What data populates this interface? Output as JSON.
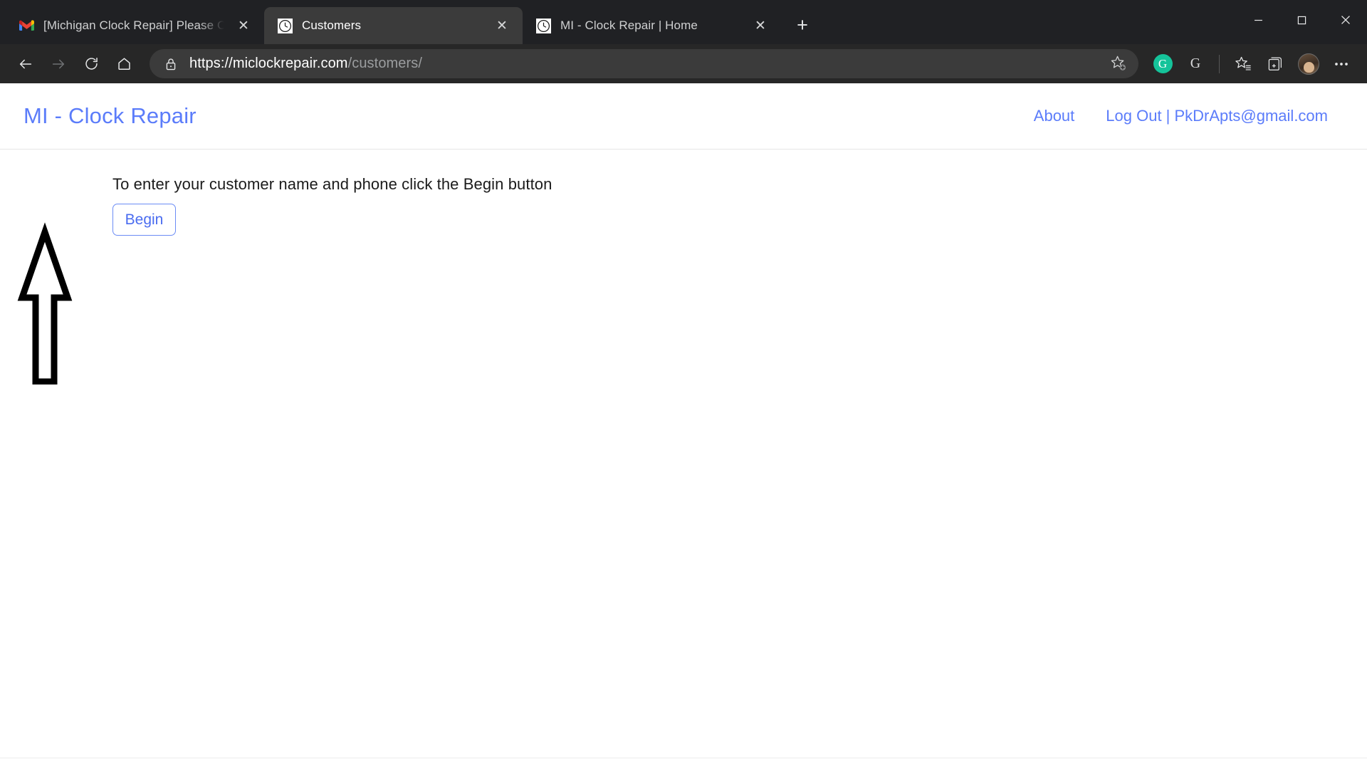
{
  "browser": {
    "tabs": [
      {
        "title": "[Michigan Clock Repair] Please C",
        "favicon": "gmail-icon",
        "active": false,
        "close_label": "✕"
      },
      {
        "title": "Customers",
        "favicon": "clock-icon",
        "active": true,
        "close_label": "✕"
      },
      {
        "title": "MI - Clock Repair | Home",
        "favicon": "clock-icon",
        "active": false,
        "close_label": "✕"
      }
    ],
    "new_tab_label": "+",
    "window_controls": {
      "minimize": "—",
      "maximize": "☐",
      "close": "✕"
    },
    "nav": {
      "back": "←",
      "forward": "→",
      "refresh": "↻",
      "home": "⌂"
    },
    "address": {
      "host": "https://miclockrepair.com",
      "path": "/customers/",
      "lock_icon": "lock-icon",
      "add_favorite_icon": "star-plus-icon"
    },
    "extensions": [
      {
        "name": "grammarly-extension",
        "label": "G"
      },
      {
        "name": "google-extension",
        "label": "G"
      }
    ],
    "toolbar_right": {
      "favorites_icon": "favorites-star-icon",
      "collections_icon": "collections-icon",
      "profile_icon": "profile-avatar",
      "settings_icon": "ellipsis-icon"
    }
  },
  "page": {
    "header": {
      "brand": "MI - Clock Repair",
      "links": [
        {
          "label": "About",
          "name": "nav-link-about"
        },
        {
          "label": "Log Out | PkDrApts@gmail.com",
          "name": "nav-link-logout"
        }
      ]
    },
    "main": {
      "instruction": "To enter your customer name and phone click the Begin button",
      "begin_button": "Begin",
      "annotation": "up-arrow-pointing-to-begin-button"
    }
  },
  "colors": {
    "brand_blue": "#5b7cfa",
    "link_blue": "#5b7cfa",
    "button_border": "#6b8cf5",
    "chrome_dark": "#202124",
    "toolbar_dark": "#272727",
    "active_tab": "#3b3b3b",
    "grammarly_green": "#15c39a"
  }
}
